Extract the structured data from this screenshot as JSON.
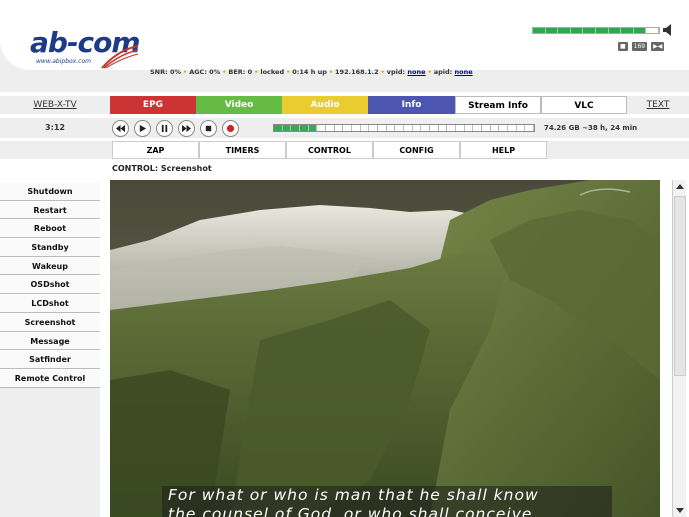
{
  "header": {
    "logo_text": "ab-com",
    "logo_sub": "www.abipbox.com",
    "status": {
      "snr": "SNR: 0%",
      "agc": "AGC: 0%",
      "ber": "BER: 0",
      "lock": "locked",
      "uptime": "0:14 h up",
      "ip": "192.168.1.2",
      "vpid_label": "vpid:",
      "vpid_value": "none",
      "apid_label": "apid:",
      "apid_value": "none"
    },
    "volume_level": 0.85,
    "mini_icons": [
      "16:9",
      "mute",
      "stereo"
    ]
  },
  "menu": {
    "webx": "WEB-X-TV",
    "epg": "EPG",
    "video": "Video",
    "audio": "Audio",
    "info": "Info",
    "stream_info": "Stream Info",
    "vlc": "VLC",
    "text": "TEXT"
  },
  "control": {
    "time": "3:12",
    "buttons": [
      "rewind",
      "play",
      "pause",
      "fast-forward",
      "stop",
      "record"
    ],
    "progress": 0.17,
    "disk": "74.26 GB ~38 h, 24 min"
  },
  "submenu": {
    "zap": "ZAP",
    "timers": "TIMERS",
    "control": "CONTROL",
    "config": "CONFIG",
    "help": "HELP"
  },
  "page_title": "CONTROL: Screenshot",
  "sidebar": {
    "items": [
      {
        "label": "Shutdown"
      },
      {
        "label": "Restart"
      },
      {
        "label": "Reboot"
      },
      {
        "label": "Standby"
      },
      {
        "label": "Wakeup"
      },
      {
        "label": "OSDshot"
      },
      {
        "label": "LCDshot"
      },
      {
        "label": "Screenshot"
      },
      {
        "label": "Message"
      },
      {
        "label": "Satfinder"
      },
      {
        "label": "Remote Control"
      }
    ]
  },
  "screenshot": {
    "subtitle_line1": "For what or who is man that he shall know",
    "subtitle_line2": "the counsel of God, or who shall conceive"
  },
  "colors": {
    "accent": "#1d3b86",
    "epg": "#cc3333",
    "video": "#66bb44",
    "audio": "#e8cc30",
    "info": "#4c55b0"
  }
}
